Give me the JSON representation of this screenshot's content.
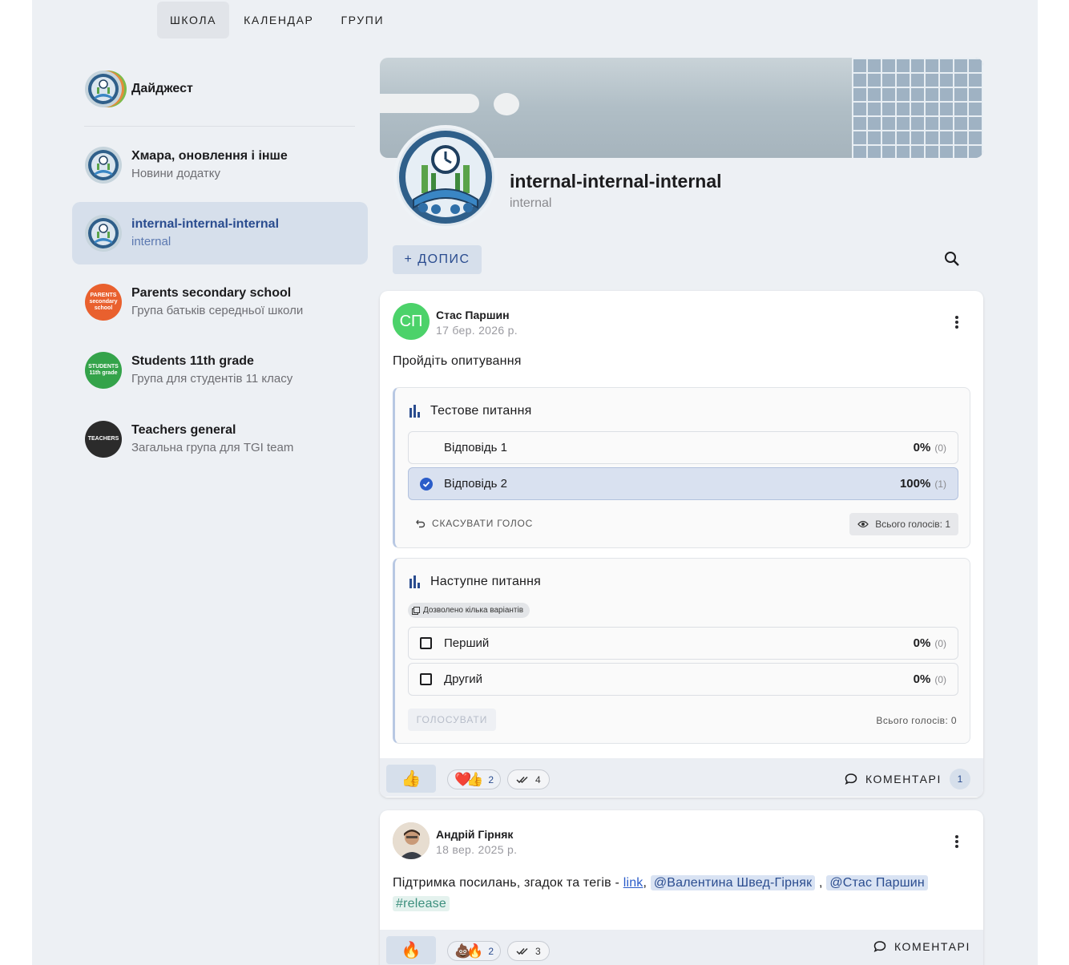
{
  "nav": {
    "tabs": [
      "ШКОЛА",
      "КАЛЕНДАР",
      "ГРУПИ"
    ],
    "active": 0
  },
  "sidebar": {
    "digest": {
      "title": "Дайджест"
    },
    "items": [
      {
        "title": "Хмара, оновлення і інше",
        "subtitle": "Новини додатку"
      },
      {
        "title": "internal-internal-internal",
        "subtitle": "internal",
        "active": true
      },
      {
        "title": "Parents secondary school",
        "subtitle": "Група батьків середньої школи",
        "avatar_text": "PARENTS secondary school",
        "avatar_color": "#e9602e"
      },
      {
        "title": "Students 11th grade",
        "subtitle": "Група для студентів 11 класу",
        "avatar_text": "STUDENTS 11th grade",
        "avatar_color": "#34a34a"
      },
      {
        "title": "Teachers general",
        "subtitle": "Загальна група для TGI team",
        "avatar_text": "TEACHERS",
        "avatar_color": "#2b2b2b"
      }
    ]
  },
  "group": {
    "title": "internal-internal-internal",
    "subtitle": "internal"
  },
  "toolbar": {
    "new_post_label": "+ ДОПИС"
  },
  "posts": [
    {
      "author": "Стас Паршин",
      "initials": "СП",
      "date": "17 бер. 2026 р.",
      "text": "Пройдіть опитування",
      "polls": [
        {
          "question": "Тестове питання",
          "options": [
            {
              "label": "Відповідь 1",
              "percent": "0%",
              "count": "(0)"
            },
            {
              "label": "Відповідь 2",
              "percent": "100%",
              "count": "(1)",
              "selected": true
            }
          ],
          "cancel_label": "СКАСУВАТИ ГОЛОС",
          "total_label": "Всього голосів: 1"
        },
        {
          "question": "Наступне питання",
          "multi_label": "Дозволено кілька варіантів",
          "options": [
            {
              "label": "Перший",
              "percent": "0%",
              "count": "(0)"
            },
            {
              "label": "Другий",
              "percent": "0%",
              "count": "(0)"
            }
          ],
          "vote_label": "ГОЛОСУВАТИ",
          "total_label": "Всього голосів: 0"
        }
      ],
      "reactions": {
        "my_reaction": "👍",
        "summary_emojis": "❤️👍",
        "summary_count": "2",
        "seen_count": "4",
        "comments_label": "КОМЕНТАРІ",
        "comments_count": "1"
      }
    },
    {
      "author": "Андрій Гірняк",
      "date": "18 вер. 2025 р.",
      "text_prefix": "Підтримка посилань, згадок та тегів - ",
      "link": "link",
      "comma1": ",",
      "mention1": "@Валентина Швед-Гірняк",
      "comma2": ",",
      "mention2": "@Стас Паршин",
      "tag": "#release",
      "reactions": {
        "my_reaction": "🔥",
        "summary_emojis": "💩🔥",
        "summary_count": "2",
        "seen_count": "3",
        "comments_label": "КОМЕНТАРІ"
      }
    }
  ],
  "colors": {
    "accent": "#2a4c8f",
    "active_bg": "#d6dfeb",
    "page_bg": "#edf0f4"
  },
  "icons": [
    "school-logo-icon",
    "search-icon",
    "more-vert-icon",
    "bar-chart-icon",
    "undo-icon",
    "eye-icon",
    "multi-select-icon",
    "check-circle-icon",
    "checkbox-icon",
    "comment-icon",
    "double-check-icon"
  ]
}
